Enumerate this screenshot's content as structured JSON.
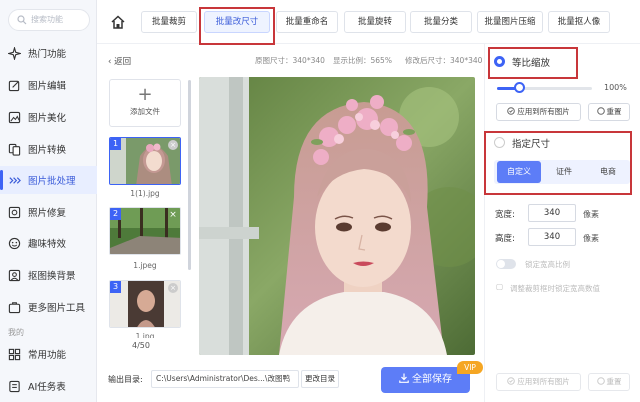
{
  "sidebar": {
    "search_placeholder": "搜索功能",
    "items": [
      {
        "label": "热门功能",
        "icon": "sparkle-icon"
      },
      {
        "label": "图片编辑",
        "icon": "edit-icon"
      },
      {
        "label": "图片美化",
        "icon": "beautify-icon"
      },
      {
        "label": "图片转换",
        "icon": "convert-icon"
      },
      {
        "label": "图片批处理",
        "icon": "batch-icon"
      },
      {
        "label": "照片修复",
        "icon": "repair-icon"
      },
      {
        "label": "趣味特效",
        "icon": "effects-icon"
      },
      {
        "label": "抠图换背景",
        "icon": "cutout-icon"
      },
      {
        "label": "更多图片工具",
        "icon": "tools-icon"
      }
    ],
    "section_label": "我的",
    "my_items": [
      {
        "label": "常用功能",
        "icon": "grid-icon"
      },
      {
        "label": "AI任务表",
        "icon": "task-icon"
      }
    ]
  },
  "tabs": [
    "批量裁剪",
    "批量改尺寸",
    "批量重命名",
    "批量旋转",
    "批量分类",
    "批量图片压缩",
    "批量抠人像"
  ],
  "crumb": "返回",
  "meta": {
    "original": "原图尺寸：340*340",
    "ratio": "显示比例：565%",
    "modified": "修改后尺寸：340*340"
  },
  "add_file": "添加文件",
  "files": [
    {
      "num": "1",
      "name": "1(1).jpg"
    },
    {
      "num": "2",
      "name": "1.jpeg"
    },
    {
      "num": "3",
      "name": "1.jpg"
    }
  ],
  "count": "4/50",
  "output": {
    "label": "输出目录:",
    "path": "C:\\Users\\Administrator\\Des...\\改图鸭",
    "change": "更改目录",
    "save": "全部保存",
    "vip": "VIP"
  },
  "right": {
    "proportional": "等比缩放",
    "percent_label": "100%",
    "scale_percent": 25,
    "apply_all": "应用到所有图片",
    "reset": "重置",
    "custom_size": "指定尺寸",
    "segments": [
      "自定义",
      "证件",
      "电商"
    ],
    "width_label": "宽度:",
    "width": "340",
    "height_label": "高度:",
    "height": "340",
    "unit": "像素",
    "lock_ratio": "锁定宽高比例",
    "adjust_note": "调整裁剪框时锁定宽高数值",
    "apply_all_bottom": "应用到所有图片",
    "reset_bottom": "重置"
  }
}
